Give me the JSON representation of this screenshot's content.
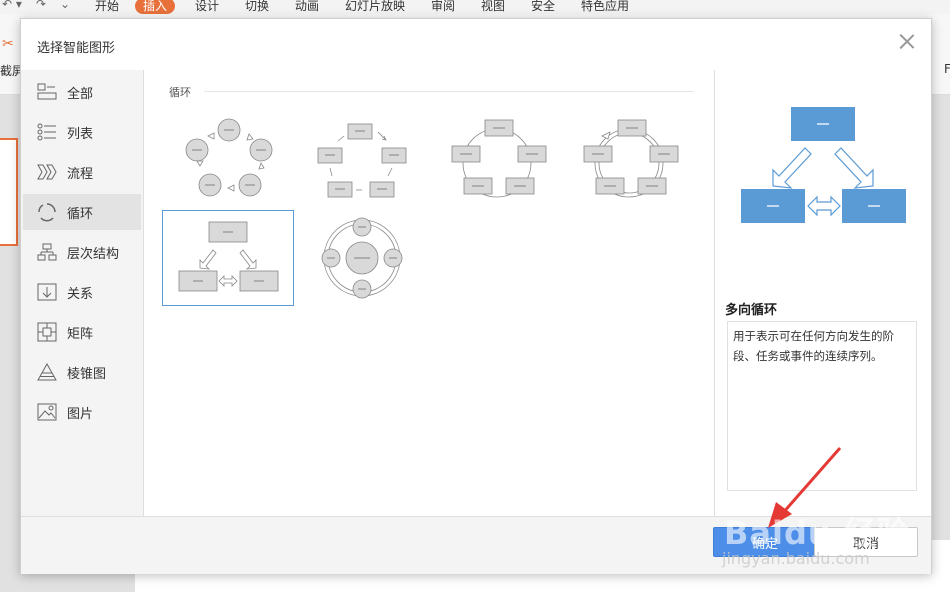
{
  "ribbon": {
    "tabs": [
      "开始",
      "插入",
      "设计",
      "切换",
      "动画",
      "幻灯片放映",
      "审阅",
      "视图",
      "安全",
      "特色应用"
    ],
    "active_tab": "插入",
    "left_tool_label": "截屏",
    "right_tool_label": "F"
  },
  "dialog": {
    "title": "选择智能图形",
    "categories": [
      {
        "label": "全部",
        "icon": "smartart-all-icon"
      },
      {
        "label": "列表",
        "icon": "list-icon"
      },
      {
        "label": "流程",
        "icon": "process-icon"
      },
      {
        "label": "循环",
        "icon": "cycle-icon"
      },
      {
        "label": "层次结构",
        "icon": "hierarchy-icon"
      },
      {
        "label": "关系",
        "icon": "relationship-icon"
      },
      {
        "label": "矩阵",
        "icon": "matrix-icon"
      },
      {
        "label": "棱锥图",
        "icon": "pyramid-icon"
      },
      {
        "label": "图片",
        "icon": "picture-icon"
      }
    ],
    "active_category": "循环",
    "section_title": "循环",
    "preview": {
      "name": "多向循环",
      "description": "用于表示可在任何方向发生的阶段、任务或事件的连续序列。"
    },
    "buttons": {
      "ok": "确定",
      "cancel": "取消"
    },
    "accent_color": "#4d8fe8"
  },
  "watermark": {
    "text": "Baidu 经验",
    "url": "jingyan.baidu.com"
  }
}
